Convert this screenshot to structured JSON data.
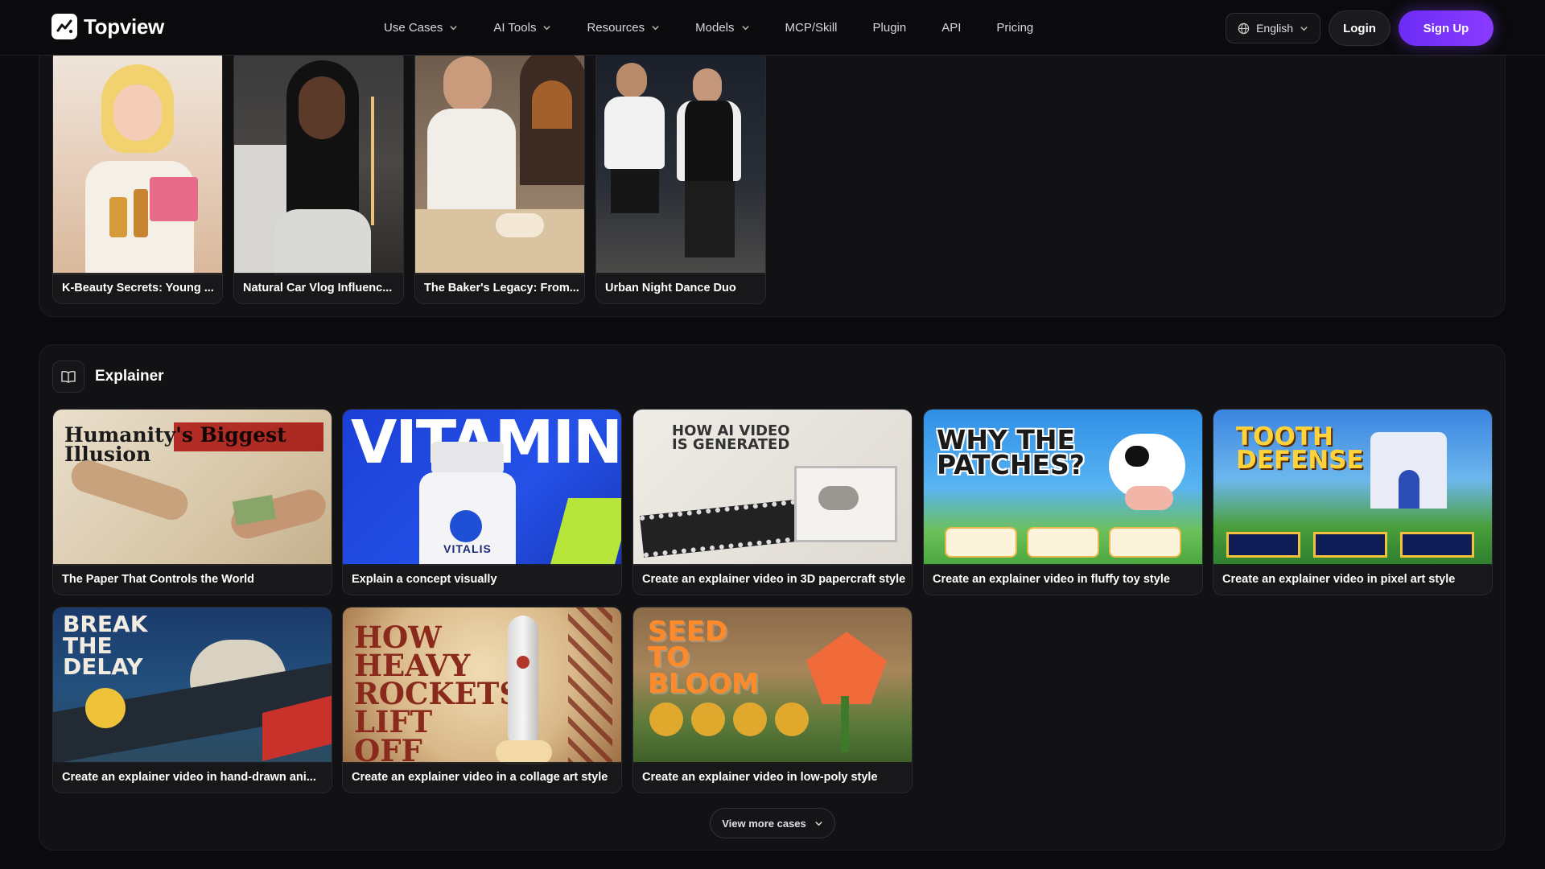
{
  "brand": {
    "name": "Topview"
  },
  "nav": {
    "items": [
      {
        "label": "Use Cases",
        "dropdown": true
      },
      {
        "label": "AI Tools",
        "dropdown": true
      },
      {
        "label": "Resources",
        "dropdown": true
      },
      {
        "label": "Models",
        "dropdown": true
      },
      {
        "label": "MCP/Skill",
        "dropdown": false
      },
      {
        "label": "Plugin",
        "dropdown": false
      },
      {
        "label": "API",
        "dropdown": false
      },
      {
        "label": "Pricing",
        "dropdown": false
      }
    ],
    "language": "English",
    "login": "Login",
    "signup": "Sign Up"
  },
  "top_cards": [
    {
      "caption": "K-Beauty Secrets: Young ..."
    },
    {
      "caption": "Natural Car Vlog Influenc..."
    },
    {
      "caption": "The Baker's Legacy: From..."
    },
    {
      "caption": "Urban Night Dance Duo"
    }
  ],
  "explainer": {
    "title": "Explainer",
    "cards": [
      {
        "caption": "The Paper That Controls the World",
        "art": "Humanity's Biggest Illusion"
      },
      {
        "caption": "Explain a concept visually",
        "art": "VITAMINS",
        "art_sub": "VITALIS"
      },
      {
        "caption": "Create an explainer video in 3D papercraft style",
        "art": "HOW AI VIDEO IS GENERATED"
      },
      {
        "caption": "Create an explainer video in fluffy toy style",
        "art": "WHY THE PATCHES?"
      },
      {
        "caption": "Create an explainer video in pixel art style",
        "art": "TOOTH DEFENSE"
      },
      {
        "caption": "Create an explainer video in hand-drawn ani...",
        "art": "BREAK THE DELAY"
      },
      {
        "caption": "Create an explainer video in a collage art style",
        "art": "HOW HEAVY ROCKETS LIFT OFF"
      },
      {
        "caption": "Create an explainer video in low-poly style",
        "art": "SEED TO BLOOM"
      }
    ],
    "view_more": "View more cases"
  },
  "colors": {
    "accent": "#7a34ff",
    "bg": "#0b0b0d",
    "panel": "#121214"
  }
}
